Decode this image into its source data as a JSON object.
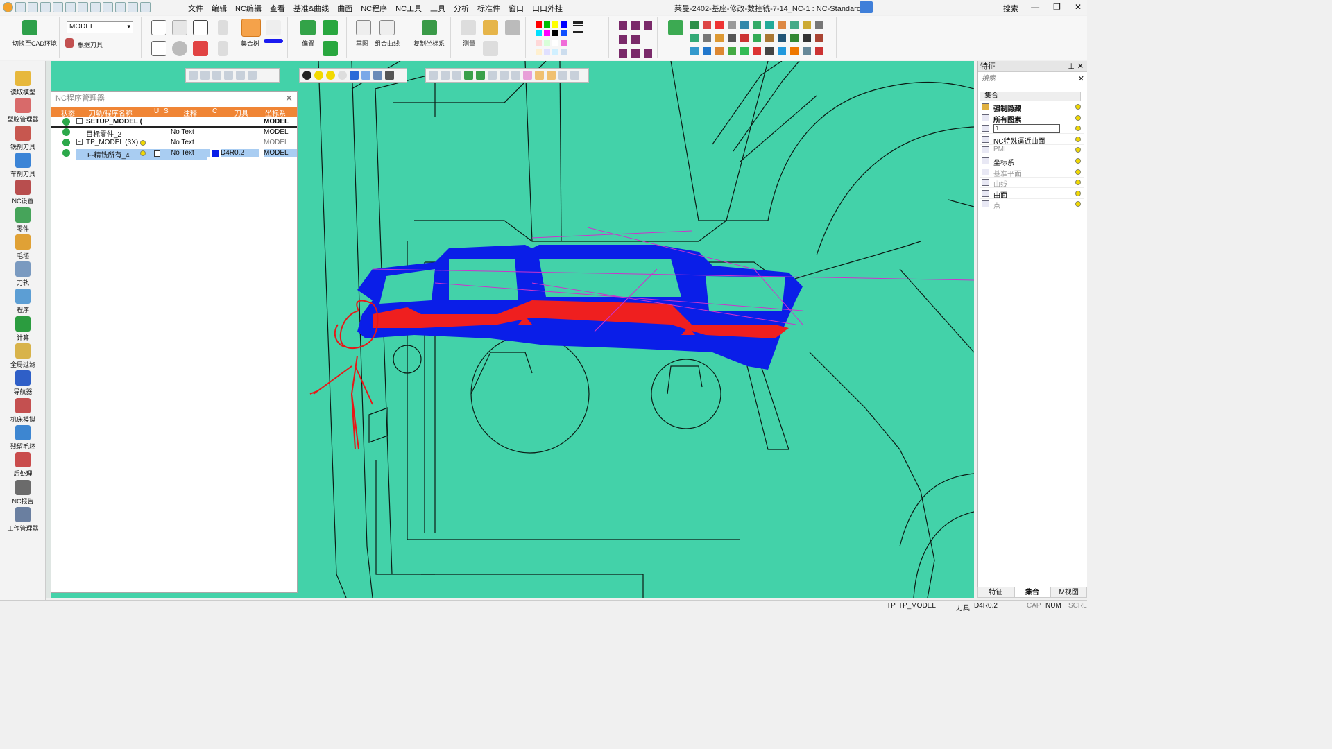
{
  "window": {
    "title": "莱曼-2402-基座-修改-数控铣-7-14_NC-1 : NC-Standard",
    "search_label": "搜索",
    "controls": [
      "⌕",
      "—",
      "❐",
      "✕"
    ]
  },
  "menu": [
    "文件",
    "编辑",
    "NC编辑",
    "查看",
    "基准&曲线",
    "曲面",
    "NC程序",
    "NC工具",
    "工具",
    "分析",
    "标准件",
    "窗口",
    "口口外挂"
  ],
  "ribbon": {
    "model_combo": "MODEL",
    "switch_cad_label": "切换至CAD环境",
    "pick_tool_label": "根据刀具",
    "labels": {
      "set_tree": "集合树",
      "offset": "偏置",
      "sketch": "草图",
      "combo_curve": "组合曲线",
      "copy_cs": "复制坐标系",
      "measure": "测量"
    }
  },
  "sidebar": [
    {
      "name": "load-model",
      "label": "读取模型",
      "color": "#e7b83c"
    },
    {
      "name": "cavity-manager",
      "label": "型腔管理器",
      "color": "#d86a6a"
    },
    {
      "name": "mill-tool",
      "label": "铣削刀具",
      "color": "#c7574f"
    },
    {
      "name": "lathe-tool",
      "label": "车削刀具",
      "color": "#3b84d6"
    },
    {
      "name": "nc-setup",
      "label": "NC设置",
      "color": "#b84e4e"
    },
    {
      "name": "part",
      "label": "零件",
      "color": "#46a45a"
    },
    {
      "name": "stock",
      "label": "毛坯",
      "color": "#e0a135"
    },
    {
      "name": "toolpath",
      "label": "刀轨",
      "color": "#7a9ac0"
    },
    {
      "name": "program",
      "label": "程序",
      "color": "#5c9ed4"
    },
    {
      "name": "compute",
      "label": "计算",
      "color": "#2b9c3f"
    },
    {
      "name": "global-filter",
      "label": "全局过滤",
      "color": "#d8b34a"
    },
    {
      "name": "navigator",
      "label": "导航器",
      "color": "#2f5fc7"
    },
    {
      "name": "machine-sim",
      "label": "机床模拟",
      "color": "#c45050"
    },
    {
      "name": "residual-stock",
      "label": "残留毛坯",
      "color": "#3d86d1"
    },
    {
      "name": "post-process",
      "label": "后处理",
      "color": "#c94c4c"
    },
    {
      "name": "nc-report",
      "label": "NC报告",
      "color": "#6b6b6b"
    },
    {
      "name": "job-manager",
      "label": "工作管理器",
      "color": "#6a7fa0"
    }
  ],
  "nc_manager": {
    "title": "NC程序管理器",
    "columns": [
      "状态",
      "刀轨/程序名称",
      "U",
      "S",
      "注释",
      "C",
      "刀具",
      "坐标系"
    ],
    "rows": [
      {
        "name": "SETUP_MODEL (",
        "comment": "",
        "tool": "",
        "cs": "MODEL",
        "bold": true
      },
      {
        "name": "目标零件_2",
        "comment": "No Text",
        "tool": "",
        "cs": "MODEL"
      },
      {
        "name": "TP_MODEL (3X)",
        "comment": "No Text",
        "tool": "",
        "cs": "MODEL"
      },
      {
        "name": "F-精铣所有_4",
        "comment": "No Text",
        "tool": "D4R0.2",
        "cs": "MODEL",
        "selected": true
      }
    ]
  },
  "right_panel": {
    "title": "特征",
    "search_placeholder": "搜索",
    "column": "集合",
    "items": [
      {
        "label": "强制隐藏",
        "bold": true
      },
      {
        "label": "所有图素",
        "bold": true
      },
      {
        "label": "1",
        "bold": false
      },
      {
        "label": "NC特殊逼近曲面",
        "bold": false
      },
      {
        "label": "PMI",
        "grey": true
      },
      {
        "label": "坐标系",
        "bold": false
      },
      {
        "label": "基准平面",
        "grey": true
      },
      {
        "label": "曲线",
        "grey": true
      },
      {
        "label": "曲面",
        "bold": false
      },
      {
        "label": "点",
        "grey": true
      }
    ],
    "tabs": [
      "特征",
      "集合",
      "M视图"
    ]
  },
  "statusbar": {
    "tp": "TP_MODEL",
    "tool_label": "刀具",
    "tool": "D4R0.2",
    "caps": "CAP",
    "num": "NUM",
    "scrl": "SCRL"
  },
  "colors": {
    "viewport": "#43d2a9",
    "toolpath": "#0a1ee8",
    "machined_face": "#ef1f1f",
    "annotation": "#e81717",
    "header": "#f08535"
  }
}
